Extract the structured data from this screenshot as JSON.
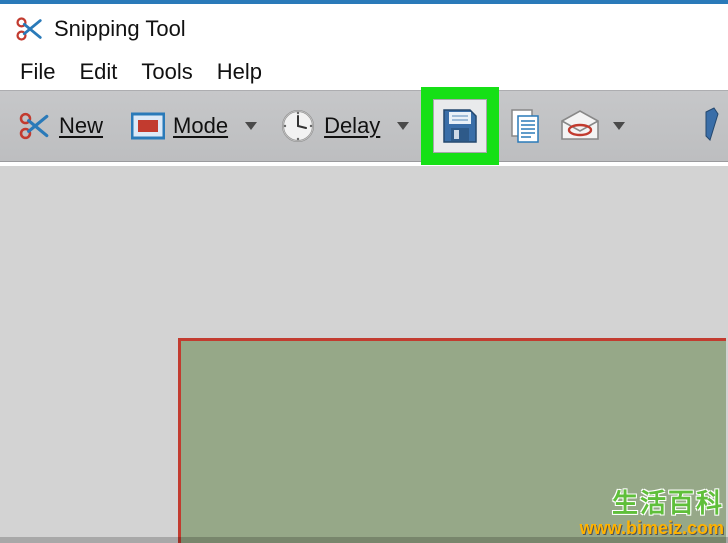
{
  "app": {
    "title": "Snipping Tool"
  },
  "menubar": {
    "items": [
      {
        "label": "File"
      },
      {
        "label": "Edit"
      },
      {
        "label": "Tools"
      },
      {
        "label": "Help"
      }
    ]
  },
  "toolbar": {
    "new_label": "New",
    "mode_label": "Mode",
    "delay_label": "Delay"
  },
  "watermark": {
    "line1": "生活百科",
    "line2": "www.bimeiz.com"
  }
}
